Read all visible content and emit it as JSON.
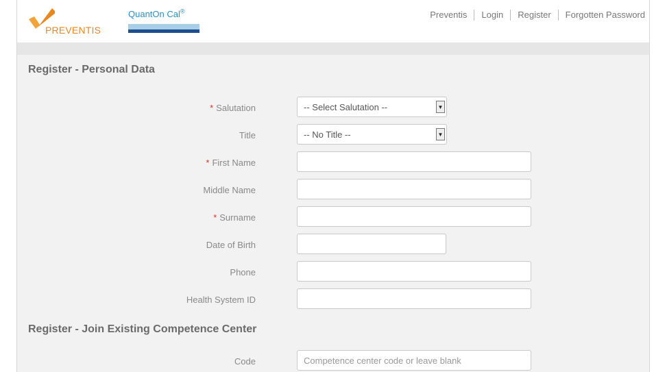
{
  "brand": {
    "logo_text": "PREVENTIS",
    "product_name": "QuantOn Cal",
    "product_mark": "®",
    "accent": "#e8871f",
    "secondary": "#2a8fc4"
  },
  "nav": [
    "Preventis",
    "Login",
    "Register",
    "Forgotten Password"
  ],
  "personal": {
    "heading": "Register - Personal Data",
    "salutation": {
      "label": "Salutation",
      "required": "*",
      "value": "-- Select Salutation --"
    },
    "title": {
      "label": "Title",
      "value": "-- No Title --"
    },
    "first_name": {
      "label": "First Name",
      "required": "*",
      "value": ""
    },
    "middle_name": {
      "label": "Middle Name",
      "value": ""
    },
    "surname": {
      "label": "Surname",
      "required": "*",
      "value": ""
    },
    "dob": {
      "label": "Date of Birth",
      "value": ""
    },
    "phone": {
      "label": "Phone",
      "value": ""
    },
    "health_id": {
      "label": "Health System ID",
      "value": ""
    }
  },
  "competence": {
    "heading": "Register - Join Existing Competence Center",
    "code": {
      "label": "Code",
      "placeholder": "Competence center code or leave blank"
    }
  }
}
